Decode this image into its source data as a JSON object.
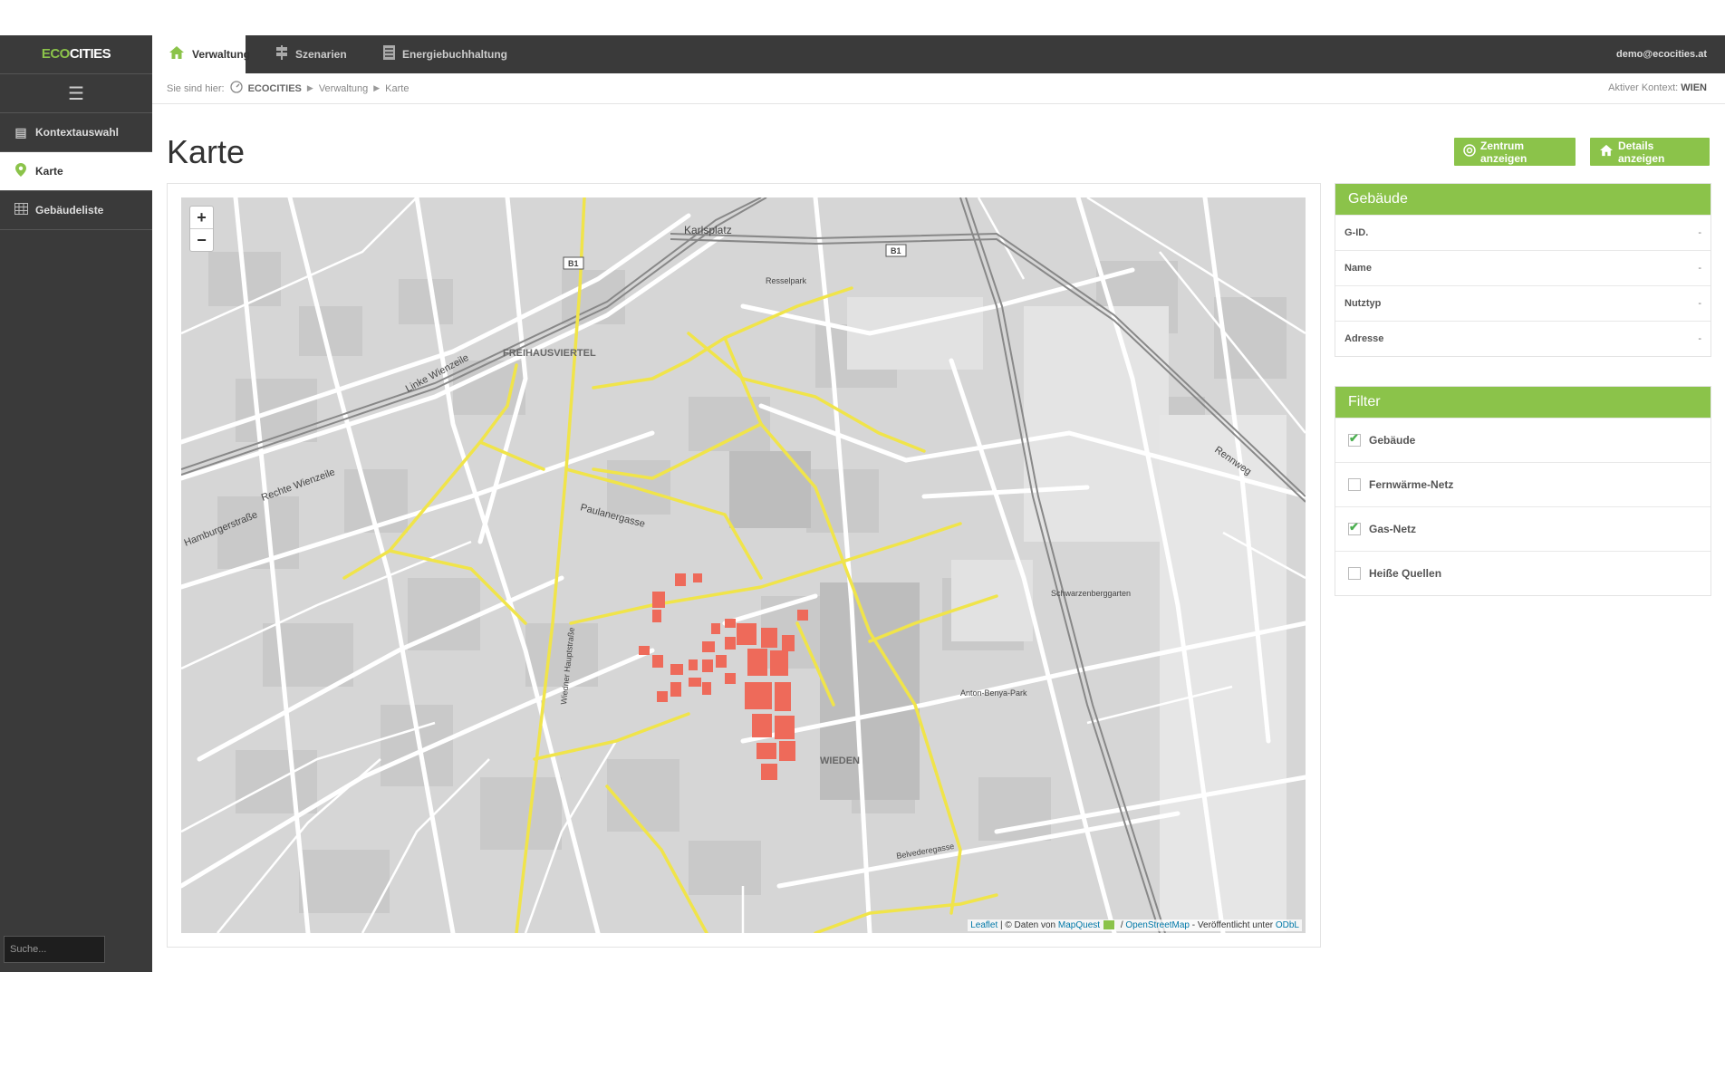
{
  "app": {
    "logo_eco": "ECO",
    "logo_cities": "CITIES",
    "user_email": "demo@ecocities.at"
  },
  "sidebar": {
    "items": [
      {
        "label": "Kontextauswahl",
        "icon": "layers-icon"
      },
      {
        "label": "Karte",
        "icon": "map-marker-icon"
      },
      {
        "label": "Gebäudeliste",
        "icon": "table-icon"
      }
    ],
    "search_placeholder": "Suche..."
  },
  "tabs": [
    {
      "label": "Verwaltung",
      "icon": "home-icon"
    },
    {
      "label": "Szenarien",
      "icon": "signpost-icon"
    },
    {
      "label": "Energiebuchhaltung",
      "icon": "ledger-icon"
    }
  ],
  "breadcrumb": {
    "prefix": "Sie sind hier:",
    "home": "ECOCITIES",
    "items": [
      "Verwaltung",
      "Karte"
    ]
  },
  "context": {
    "label": "Aktiver Kontext:",
    "value": "WIEN"
  },
  "page": {
    "title": "Karte"
  },
  "actions": {
    "center_label": "Zentrum anzeigen",
    "details_label": "Details anzeigen"
  },
  "map": {
    "zoom_in": "+",
    "zoom_out": "−",
    "attribution": {
      "leaflet": "Leaflet",
      "data_prefix": " | © Daten von ",
      "mapquest": "MapQuest",
      "sep": " / ",
      "osm": "OpenStreetMap",
      "license_prefix": " - Veröffentlicht unter ",
      "odbl": "ODbL"
    },
    "labels": {
      "karlsplatz": "Karlsplatz",
      "resselpark": "Resselpark",
      "freihausviertel": "FREIHAUSVIERTEL",
      "wieden": "WIEDEN",
      "paulanergasse": "Paulanergasse",
      "schwarzenbergplatz": "Schwarzenberggarten",
      "anton_benya_park": "Anton-Benya-Park",
      "rennweg": "Rennweg",
      "linke_wienzeile": "Linke Wienzeile",
      "rechte_wienzeile": "Rechte Wienzeile",
      "hamburgerstrasse": "Hamburgerstraße",
      "wiedner_hauptstrasse": "Wiedner Hauptstraße",
      "belvederegasse": "Belvederegasse",
      "b1": "B1"
    },
    "colors": {
      "gas_network": "#f0e44a",
      "buildings": "#ee6a5a"
    }
  },
  "gebaeude": {
    "title": "Gebäude",
    "fields": [
      {
        "label": "G-ID.",
        "value": "-"
      },
      {
        "label": "Name",
        "value": "-"
      },
      {
        "label": "Nutztyp",
        "value": "-"
      },
      {
        "label": "Adresse",
        "value": "-"
      }
    ]
  },
  "filter": {
    "title": "Filter",
    "items": [
      {
        "label": "Gebäude",
        "checked": true
      },
      {
        "label": "Fernwärme-Netz",
        "checked": false
      },
      {
        "label": "Gas-Netz",
        "checked": true
      },
      {
        "label": "Heiße Quellen",
        "checked": false
      }
    ]
  }
}
